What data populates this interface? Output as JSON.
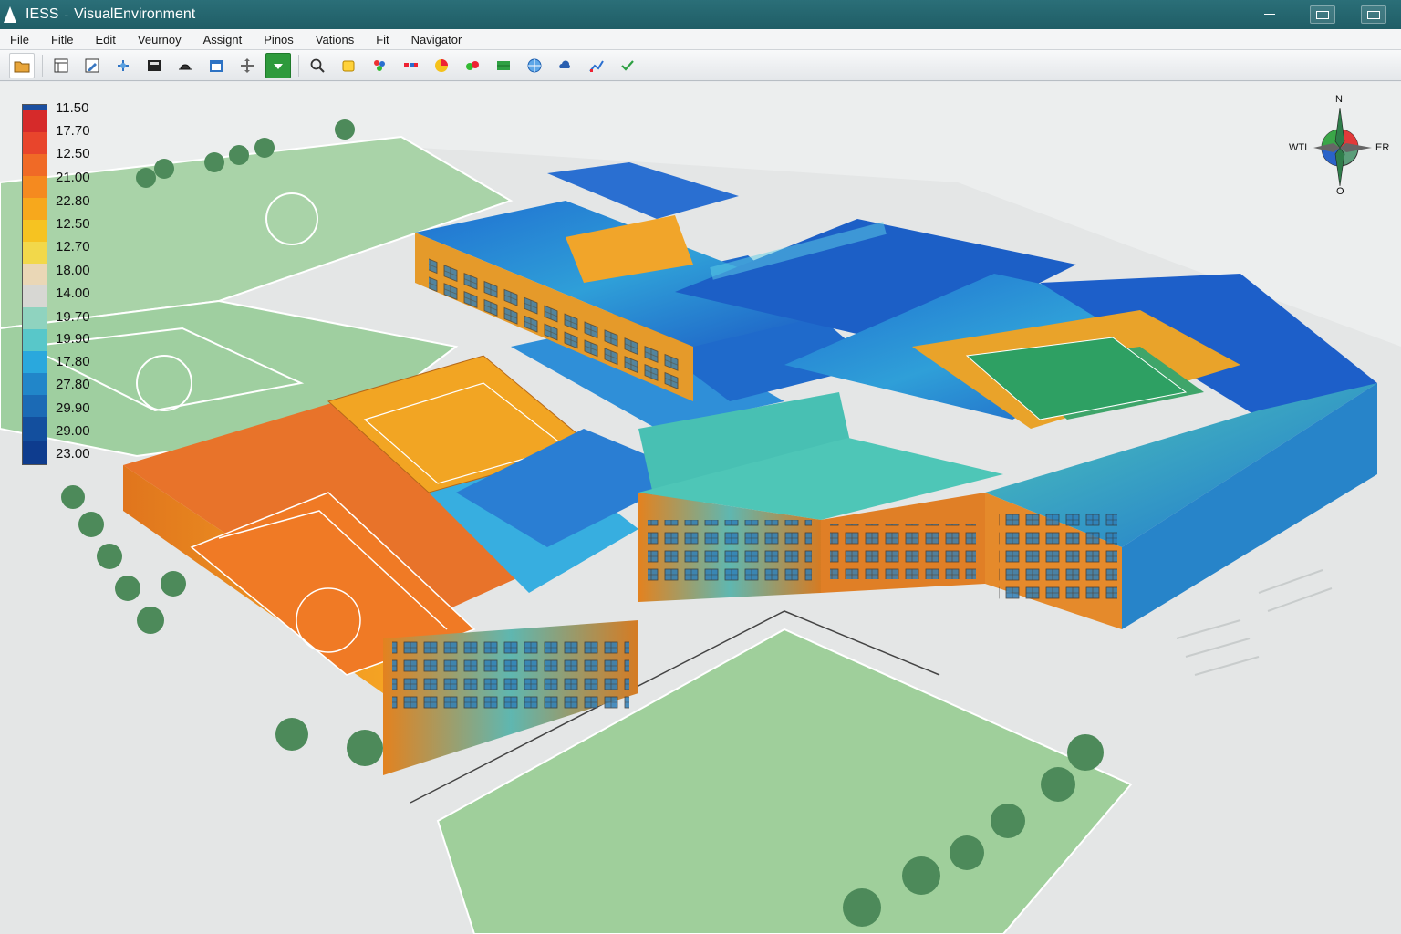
{
  "window": {
    "app_name": "IESS",
    "separator": "-",
    "document_title": "VisualEnvironment"
  },
  "menu": {
    "items": [
      {
        "label": "File"
      },
      {
        "label": "Fitle"
      },
      {
        "label": "Edit"
      },
      {
        "label": "Veurnoy"
      },
      {
        "label": "Assignt"
      },
      {
        "label": "Pinos"
      },
      {
        "label": "Vations"
      },
      {
        "label": "Fit"
      },
      {
        "label": "Navigator"
      }
    ]
  },
  "toolbar": {
    "buttons": [
      {
        "icon": "folder-open-icon"
      },
      {
        "icon": "layout-icon"
      },
      {
        "icon": "edit-view-icon"
      },
      {
        "icon": "move-icon"
      },
      {
        "icon": "model-dark-icon"
      },
      {
        "icon": "hardhat-icon"
      },
      {
        "icon": "calendar-icon"
      },
      {
        "icon": "arrows-icon"
      },
      {
        "icon": "green-select-icon"
      },
      {
        "icon": "search-icon"
      },
      {
        "icon": "sun-icon"
      },
      {
        "icon": "color-tool-icon"
      },
      {
        "icon": "palette-icon"
      },
      {
        "icon": "pie-icon"
      },
      {
        "icon": "leaf-icon"
      },
      {
        "icon": "green-grid-icon"
      },
      {
        "icon": "globe-icon"
      },
      {
        "icon": "cloud-icon"
      },
      {
        "icon": "chart-line-icon"
      },
      {
        "icon": "check-icon"
      }
    ]
  },
  "legend": {
    "labels": [
      "11.50",
      "17.70",
      "12.50",
      "21.00",
      "22.80",
      "12.50",
      "12.70",
      "18.00",
      "14.00",
      "19.70",
      "19.90",
      "17.80",
      "27.80",
      "29.90",
      "29.00",
      "23.00"
    ],
    "colors": [
      "#d62a2a",
      "#e8452c",
      "#f06a26",
      "#f58a1f",
      "#f7a81c",
      "#f6c321",
      "#f2d84a",
      "#ead7b6",
      "#d7d7d3",
      "#8fd3bf",
      "#58c7c9",
      "#2aa8dd",
      "#2186c9",
      "#1b6ab5",
      "#134f9e",
      "#0e3c8e"
    ]
  },
  "compass": {
    "north": "N",
    "west": "WTI",
    "east": "ER",
    "south": "O"
  }
}
